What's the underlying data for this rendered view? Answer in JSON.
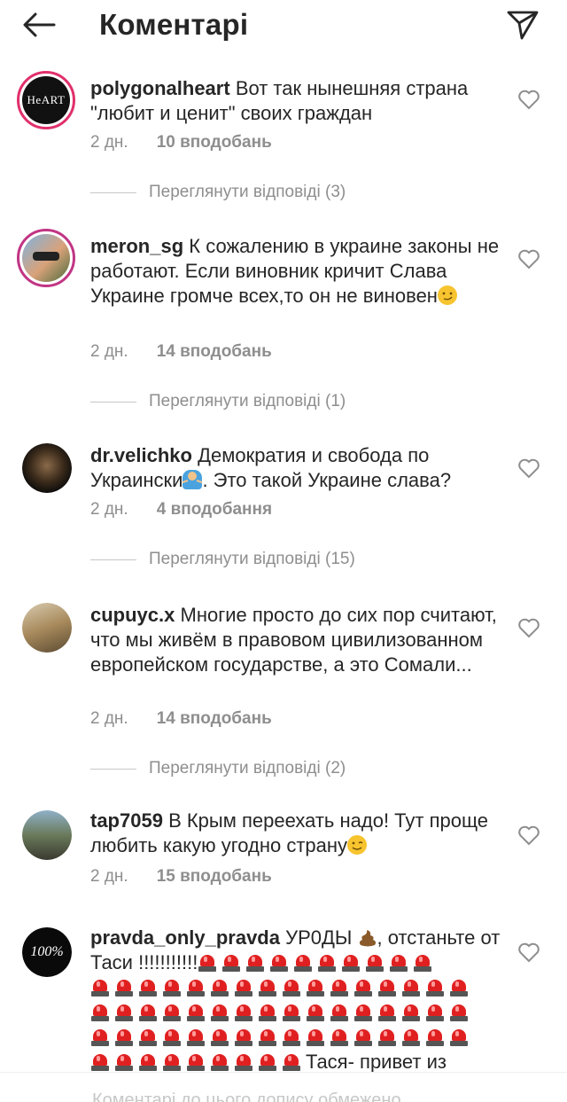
{
  "header": {
    "title": "Коментарі",
    "back_icon": "arrow-left-icon",
    "send_icon": "paper-plane-icon"
  },
  "comments": [
    {
      "username": "polygonalheart",
      "text": "Вот так нынешняя страна \"любит и ценит\" своих граждан",
      "time": "2 дн.",
      "likes": "10 вподобань",
      "replies": "Переглянути відповіді (3)",
      "avatar_label": "HeART"
    },
    {
      "username": "meron_sg",
      "text": "К сожалению в украине законы не работают. Если виновник кричит Слава Украине громче всех,то он не виновен",
      "time": "2 дн.",
      "likes": "14 вподобань",
      "replies": "Переглянути відповіді (1)"
    },
    {
      "username": "dr.velichko",
      "text": "Демократия и свобода по Украински",
      "text2": ". Это такой Украине слава?",
      "time": "2 дн.",
      "likes": "4 вподобання",
      "replies": "Переглянути відповіді (15)"
    },
    {
      "username": "cupuyc.x",
      "text": "Многие просто до сих пор считают, что мы живём в правовом цивилизованном европейском государстве, а это Сомали...",
      "time": "2 дн.",
      "likes": "14 вподобань",
      "replies": "Переглянути відповіді (2)"
    },
    {
      "username": "tap7059",
      "text": "В Крым переехать надо! Тут проще любить какую угодно страну",
      "time": "2 дн.",
      "likes": "15 вподобань"
    },
    {
      "username": "pravda_only_pravda",
      "text": "УР0ДЫ",
      "text2": ", отстаньте от Таси !!!!!!!!!!!",
      "tail": "Тася- привет из",
      "avatar_label": "100%"
    }
  ],
  "footer": {
    "text": "Коментарі до цього допису обмежено"
  },
  "colors": {
    "muted": "#8e8e8e",
    "text": "#262626",
    "ring": "#e1306c"
  }
}
